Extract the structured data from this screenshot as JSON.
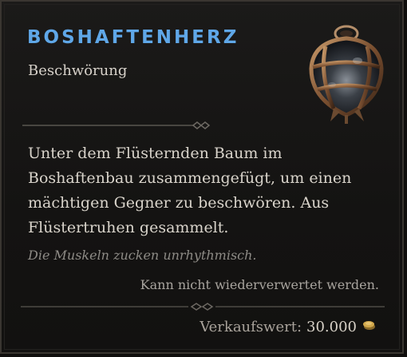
{
  "item": {
    "name": "BOSHAFTENHERZ",
    "type": "Beschwörung",
    "icon": "cage-heart-icon",
    "description": "Unter dem Flüsternden Baum im Boshaftenbau zusammengefügt, um einen mächtigen Gegner zu beschwören. Aus Flüstertruhen gesammelt.",
    "flavor": "Die Muskeln zucken unrhythmisch.",
    "salvage_note": "Kann nicht wiederverwertet werden.",
    "sell_label": "Verkaufswert:",
    "sell_value": "30.000",
    "currency_icon": "gold-coin-icon"
  },
  "colors": {
    "title": "#5fa7e8",
    "text": "#d9d4cb",
    "flavor": "#8e8b86",
    "background": "#161514"
  }
}
